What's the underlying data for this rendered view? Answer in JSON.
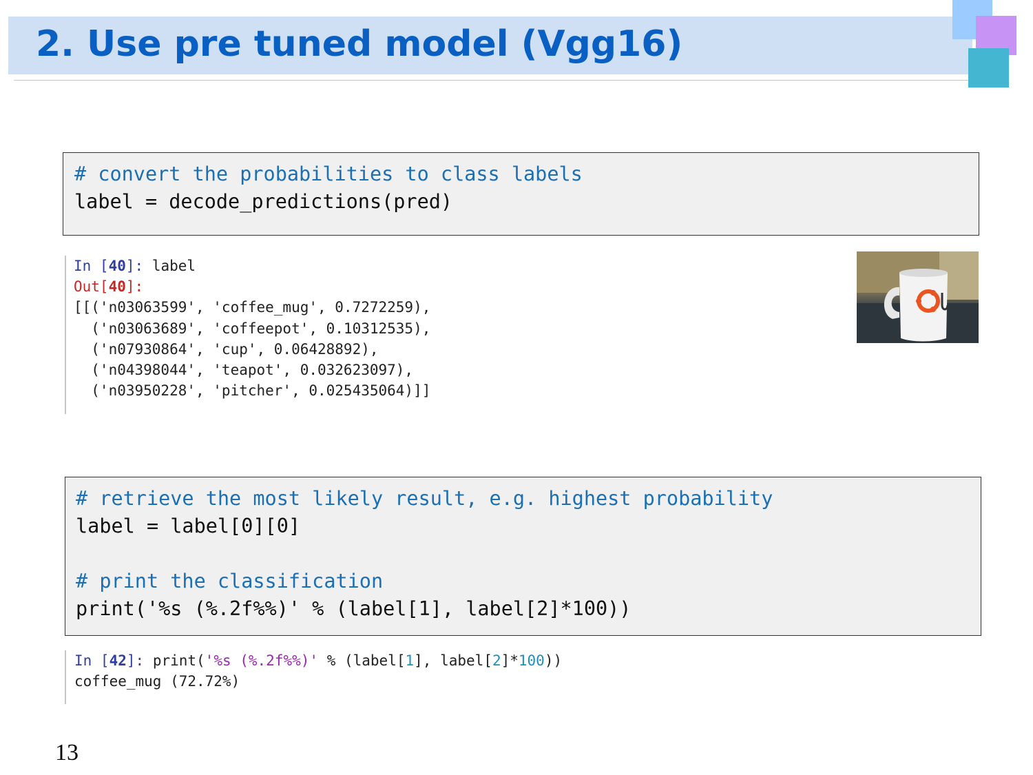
{
  "slide": {
    "title": "2. Use pre tuned model (Vgg16)",
    "page_number": "13"
  },
  "code_block_1": {
    "comment": "# convert the probabilities to class labels",
    "line": "label = decode_predictions(pred)"
  },
  "notebook_1": {
    "in_prefix": "In [",
    "in_number": "40",
    "in_suffix": "]: ",
    "in_code": "label",
    "out_prefix": "Out[",
    "out_number": "40",
    "out_suffix": "]:",
    "output_lines": [
      "[[('n03063599', 'coffee_mug', 0.7272259),",
      "  ('n03063689', 'coffeepot', 0.10312535),",
      "  ('n07930864', 'cup', 0.06428892),",
      "  ('n04398044', 'teapot', 0.032623097),",
      "  ('n03950228', 'pitcher', 0.025435064)]]"
    ]
  },
  "code_block_2": {
    "comment_1": "# retrieve the most likely result, e.g. highest probability",
    "line_1": "label = label[0][0]",
    "comment_2": "# print the classification",
    "line_2": "print('%s (%.2f%%)' % (label[1], label[2]*100))"
  },
  "notebook_2": {
    "in_prefix": "In [",
    "in_number": "42",
    "in_suffix": "]: ",
    "code_parts": {
      "p1": "print(",
      "s1": "'%s (%.2f%%)'",
      "p2": " % (label[",
      "n1": "1",
      "p3": "], label[",
      "n2": "2",
      "p4": "]*",
      "n3": "100",
      "p5": "))"
    },
    "output": "coffee_mug (72.72%)"
  },
  "colors": {
    "title": "#0a5fc2",
    "title_bar": "#cfe0f4",
    "comment": "#1b6fb2",
    "code_bg": "#f0f0f0",
    "in_prompt": "#303f9f",
    "out_prompt": "#c62828"
  },
  "image": {
    "description_name": "coffee-mug-photo"
  }
}
